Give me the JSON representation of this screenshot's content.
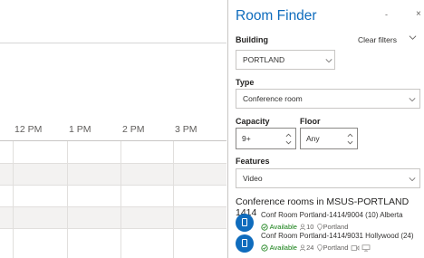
{
  "calendar": {
    "times": [
      "12 PM",
      "1 PM",
      "2 PM",
      "3 PM"
    ]
  },
  "room_finder": {
    "title": "Room Finder",
    "minimize_glyph": "-",
    "close_glyph": "×",
    "building_label": "Building",
    "clear_filters": "Clear filters",
    "building_value": "PORTLAND",
    "type_label": "Type",
    "type_value": "Conference room",
    "capacity_label": "Capacity",
    "capacity_value": "9+",
    "floor_label": "Floor",
    "floor_value": "Any",
    "features_label": "Features",
    "features_value": "Video",
    "results_title": "Conference rooms in MSUS-PORTLAND 1414",
    "rooms": [
      {
        "name": "Conf Room Portland-1414/9004 (10) Alberta",
        "status": "Available",
        "capacity": "10",
        "location": "Portland"
      },
      {
        "name": "Conf Room Portland-1414/9031 Hollywood (24)",
        "status": "Available",
        "capacity": "24",
        "location": "Portland"
      }
    ]
  },
  "colors": {
    "accent": "#0f6cbd",
    "available": "#107c10",
    "row_gray": "#f3f2f1"
  },
  "icons": [
    "chevron-down-icon",
    "chevron-up-icon",
    "door-icon",
    "check-circle-icon",
    "person-icon",
    "location-pin-icon",
    "video-icon",
    "monitor-icon"
  ]
}
